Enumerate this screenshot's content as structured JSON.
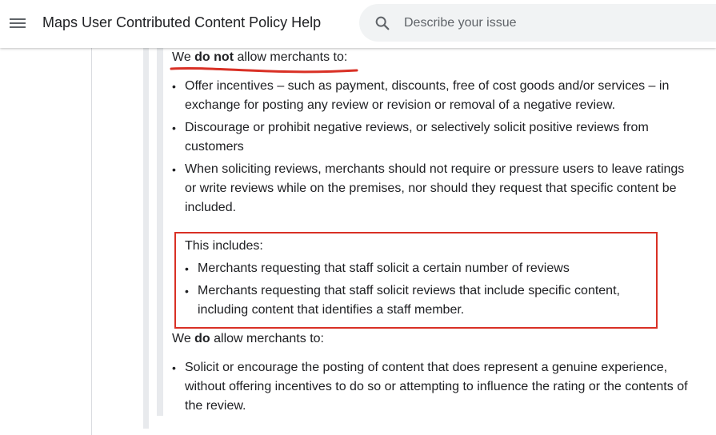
{
  "header": {
    "title": "Maps User Contributed Content Policy Help",
    "search_placeholder": "Describe your issue"
  },
  "content": {
    "do_not": {
      "prefix": "We ",
      "bold": "do not",
      "suffix": " allow merchants to:",
      "items": [
        "Offer incentives – such as payment, discounts, free of cost goods and/or services – in exchange for posting any review or revision or removal of a negative review.",
        "Discourage or prohibit negative reviews, or selectively solicit positive reviews from customers",
        "When soliciting reviews, merchants should not require or pressure users to leave ratings or write reviews while on the premises, nor should they request that specific content be included."
      ]
    },
    "includes": {
      "title": "This includes:",
      "items": [
        "Merchants requesting that staff solicit a certain number of reviews",
        "Merchants requesting that staff solicit reviews that include specific content, including content that identifies a staff member."
      ]
    },
    "do": {
      "prefix": "We ",
      "bold": "do",
      "suffix": " allow merchants to:",
      "items": [
        "Solicit or encourage the posting of content that does represent a genuine experience, without offering incentives to do so or attempting to influence the rating or the contents of the review."
      ]
    }
  },
  "colors": {
    "annotation_red": "#d93025",
    "accent_bar": "#e8eaed",
    "text": "#202124"
  },
  "icons": {
    "menu": "menu-icon",
    "search": "search-icon"
  }
}
